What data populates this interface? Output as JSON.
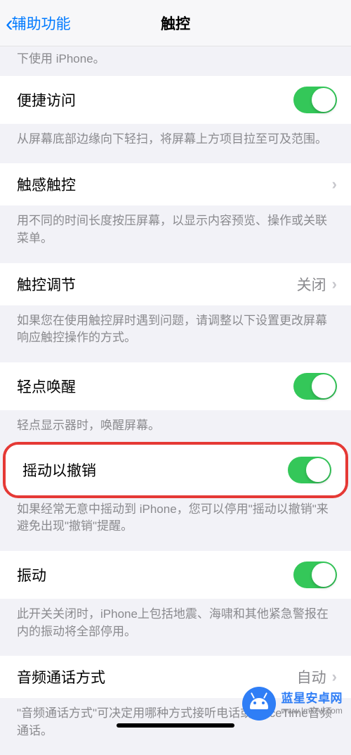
{
  "nav": {
    "back_label": "辅助功能",
    "title": "触控"
  },
  "partial_top_desc": "下使用 iPhone。",
  "sections": {
    "reachability": {
      "title": "便捷访问",
      "desc": "从屏幕底部边缘向下轻扫，将屏幕上方项目拉至可及范围。",
      "on": true
    },
    "haptic_touch": {
      "title": "触感触控",
      "desc": "用不同的时间长度按压屏幕，以显示内容预览、操作或关联菜单。"
    },
    "touch_accommodations": {
      "title": "触控调节",
      "value": "关闭",
      "desc": "如果您在使用触控屏时遇到问题，请调整以下设置更改屏幕响应触控操作的方式。"
    },
    "tap_to_wake": {
      "title": "轻点唤醒",
      "desc": "轻点显示器时，唤醒屏幕。",
      "on": true
    },
    "shake_to_undo": {
      "title": "摇动以撤销",
      "desc": "如果经常无意中摇动到 iPhone，您可以停用\"摇动以撤销\"来避免出现\"撤销\"提醒。",
      "on": true
    },
    "vibration": {
      "title": "振动",
      "desc": "此开关关闭时，iPhone上包括地震、海啸和其他紧急警报在内的振动将全部停用。",
      "on": true
    },
    "call_audio_routing": {
      "title": "音频通话方式",
      "value": "自动",
      "desc": "\"音频通话方式\"可决定用哪种方式接听电话或 FaceTime音频通话。"
    }
  },
  "watermark": {
    "line1": "蓝星安卓网",
    "line2": "www.lmkzw.com"
  }
}
